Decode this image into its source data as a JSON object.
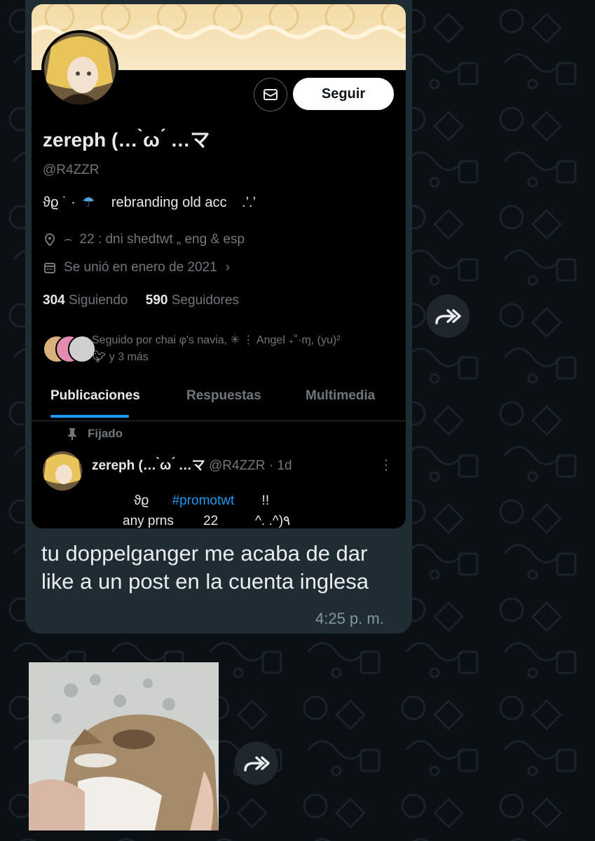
{
  "chat": {
    "message": {
      "text": "tu doppelganger me acaba de dar like a un post en la cuenta inglesa",
      "time": "4:25 p. m."
    },
    "forward_icon": "forward-arrow-icon"
  },
  "embed": {
    "profile": {
      "name": "zereph (… ̀ω ́ …マ",
      "handle": "@R4ZZR",
      "bio_symbol": "ϑϱ ˙ ·",
      "bio_text": "rebranding old acc",
      "bio_suffix": ".’.’",
      "location_glyph": "⌢",
      "location": "22  :  dni shedtwt „ eng & esp",
      "joined": "Se unió en enero de 2021",
      "following_count": "304",
      "following_label": "Siguiendo",
      "followers_count": "590",
      "followers_label": "Seguidores",
      "followed_by_line1": "Seguido por chai φ's navia,  ✳  ⋮  Angel ₊˚·ɱ, (yu)²",
      "followed_by_line2": "y 3 más",
      "follow_button": "Seguir"
    },
    "tabs": [
      "Publicaciones",
      "Respuestas",
      "Multimedia"
    ],
    "pinned_label": "Fijado",
    "pinned_post": {
      "author": "zereph (… ̀ω ́ …マ",
      "meta": "@R4ZZR · 1d",
      "line1_start": "ϑϱ",
      "hashtag": "#promotwt",
      "line1_end": "!!",
      "line2": "any prns        22          ^. .^)٩",
      "more": "⋮"
    }
  },
  "colors": {
    "bubble": "#202c33",
    "chat_background": "#0b1014",
    "twitter_blue": "#1d9bf0",
    "muted_text": "#71767b"
  }
}
